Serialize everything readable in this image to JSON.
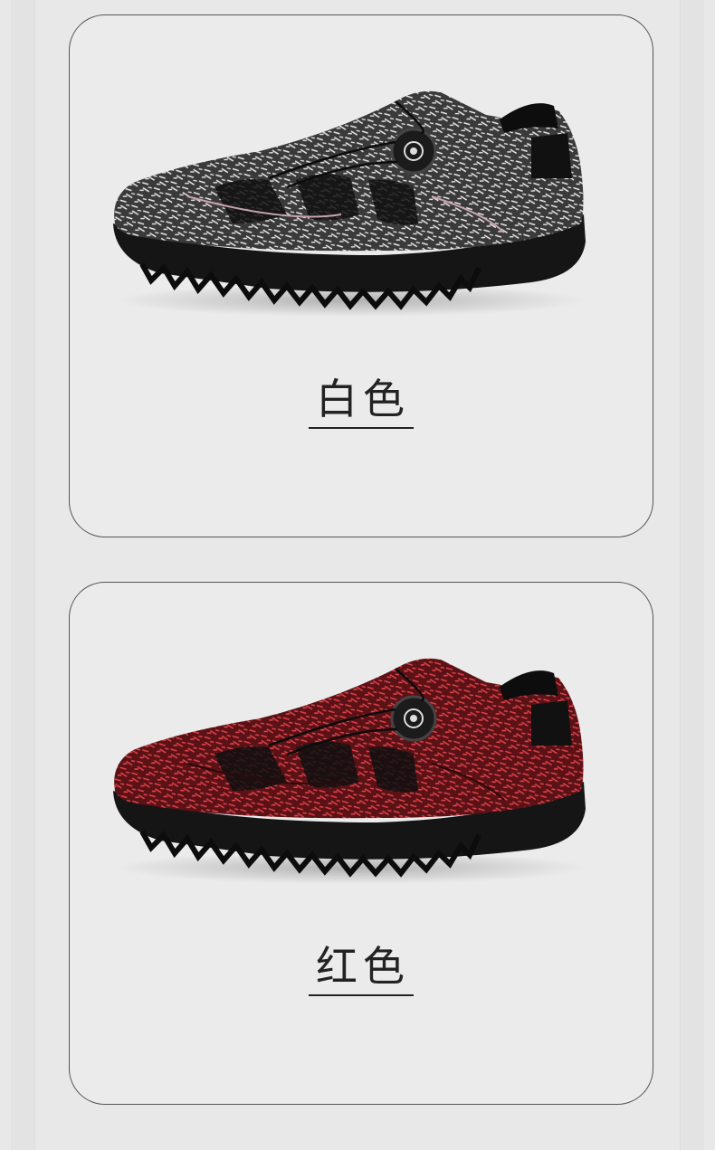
{
  "products": [
    {
      "color_label": "白色",
      "shoe_color": "#9a9a9a",
      "pattern_color": "#ffffff"
    },
    {
      "color_label": "红色",
      "shoe_color": "#7a1a1e",
      "pattern_color": "#e0424a"
    }
  ]
}
